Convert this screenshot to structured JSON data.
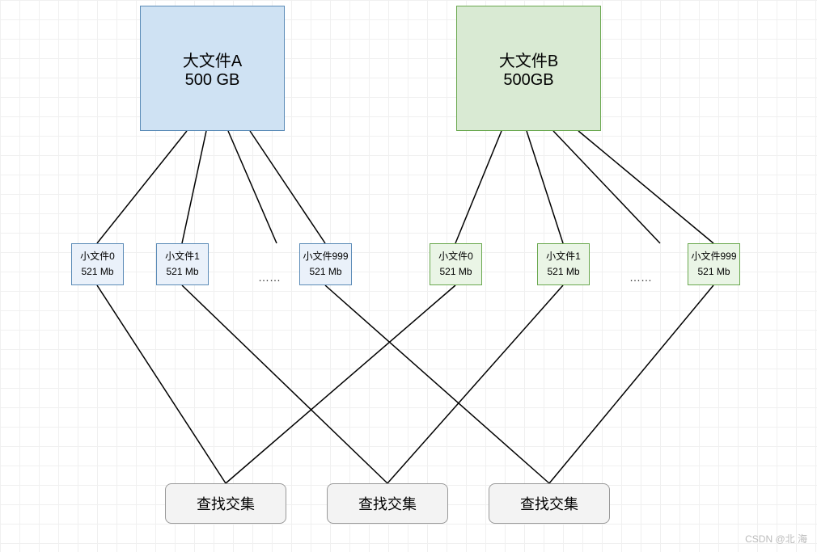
{
  "bigFiles": {
    "a": {
      "name": "大文件A",
      "size": "500 GB"
    },
    "b": {
      "name": "大文件B",
      "size": "500GB"
    }
  },
  "smallFiles": {
    "a": [
      {
        "name": "小文件0",
        "size": "521 Mb"
      },
      {
        "name": "小文件1",
        "size": "521 Mb"
      },
      {
        "name": "小文件999",
        "size": "521 Mb"
      }
    ],
    "b": [
      {
        "name": "小文件0",
        "size": "521 Mb"
      },
      {
        "name": "小文件1",
        "size": "521 Mb"
      },
      {
        "name": "小文件999",
        "size": "521 Mb"
      }
    ]
  },
  "ellipsis": "……",
  "results": [
    {
      "label": "查找交集"
    },
    {
      "label": "查找交集"
    },
    {
      "label": "查找交集"
    }
  ],
  "watermark": "CSDN @北    海",
  "colors": {
    "blueFill": "#cfe2f3",
    "blueBorder": "#5b8bb7",
    "greenFill": "#d9ead3",
    "greenBorder": "#6aa84f",
    "greyFill": "#f3f3f3",
    "greyBorder": "#999999"
  }
}
